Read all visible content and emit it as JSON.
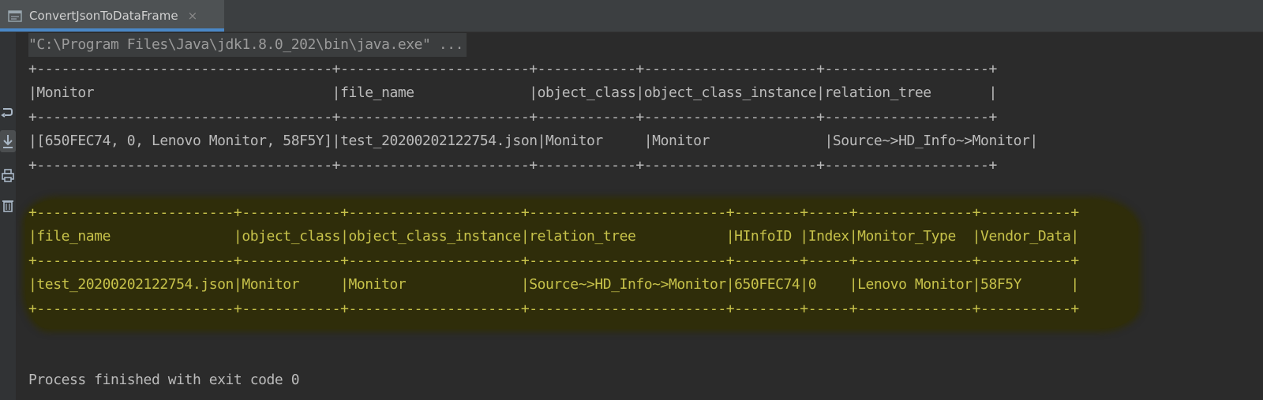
{
  "tab": {
    "icon": "console-window-icon",
    "title": "ConvertJsonToDataFrame",
    "close_glyph": "×"
  },
  "gutter": {
    "icons": [
      "rerun-icon",
      "scroll-to-end-icon",
      "print-icon",
      "trash-icon"
    ]
  },
  "console": {
    "command": "\"C:\\Program Files\\Java\\jdk1.8.0_202\\bin\\java.exe\" ...",
    "table1": {
      "border": "+------------------------------------+-----------------------+------------+---------------------+--------------------+",
      "header": "|Monitor                             |file_name              |object_class|object_class_instance|relation_tree       |",
      "row": "|[650FEC74, 0, Lenovo Monitor, 58F5Y]|test_20200202122754.json|Monitor     |Monitor              |Source~>HD_Info~>Monitor|"
    },
    "table2": {
      "border": "+------------------------+------------+---------------------+------------------------+--------+-----+--------------+-----------+",
      "header": "|file_name               |object_class|object_class_instance|relation_tree           |HInfoID |Index|Monitor_Type  |Vendor_Data|",
      "row": "|test_20200202122754.json|Monitor     |Monitor              |Source~>HD_Info~>Monitor|650FEC74|0    |Lenovo Monitor|58F5Y      |"
    },
    "exit_message": "Process finished with exit code 0"
  },
  "colors": {
    "background": "#2b2b2b",
    "text": "#bbbbbb",
    "highlight_text": "#c7c24a",
    "highlight_bg": "#2f2d0a",
    "tab_accent": "#4a88c7"
  }
}
